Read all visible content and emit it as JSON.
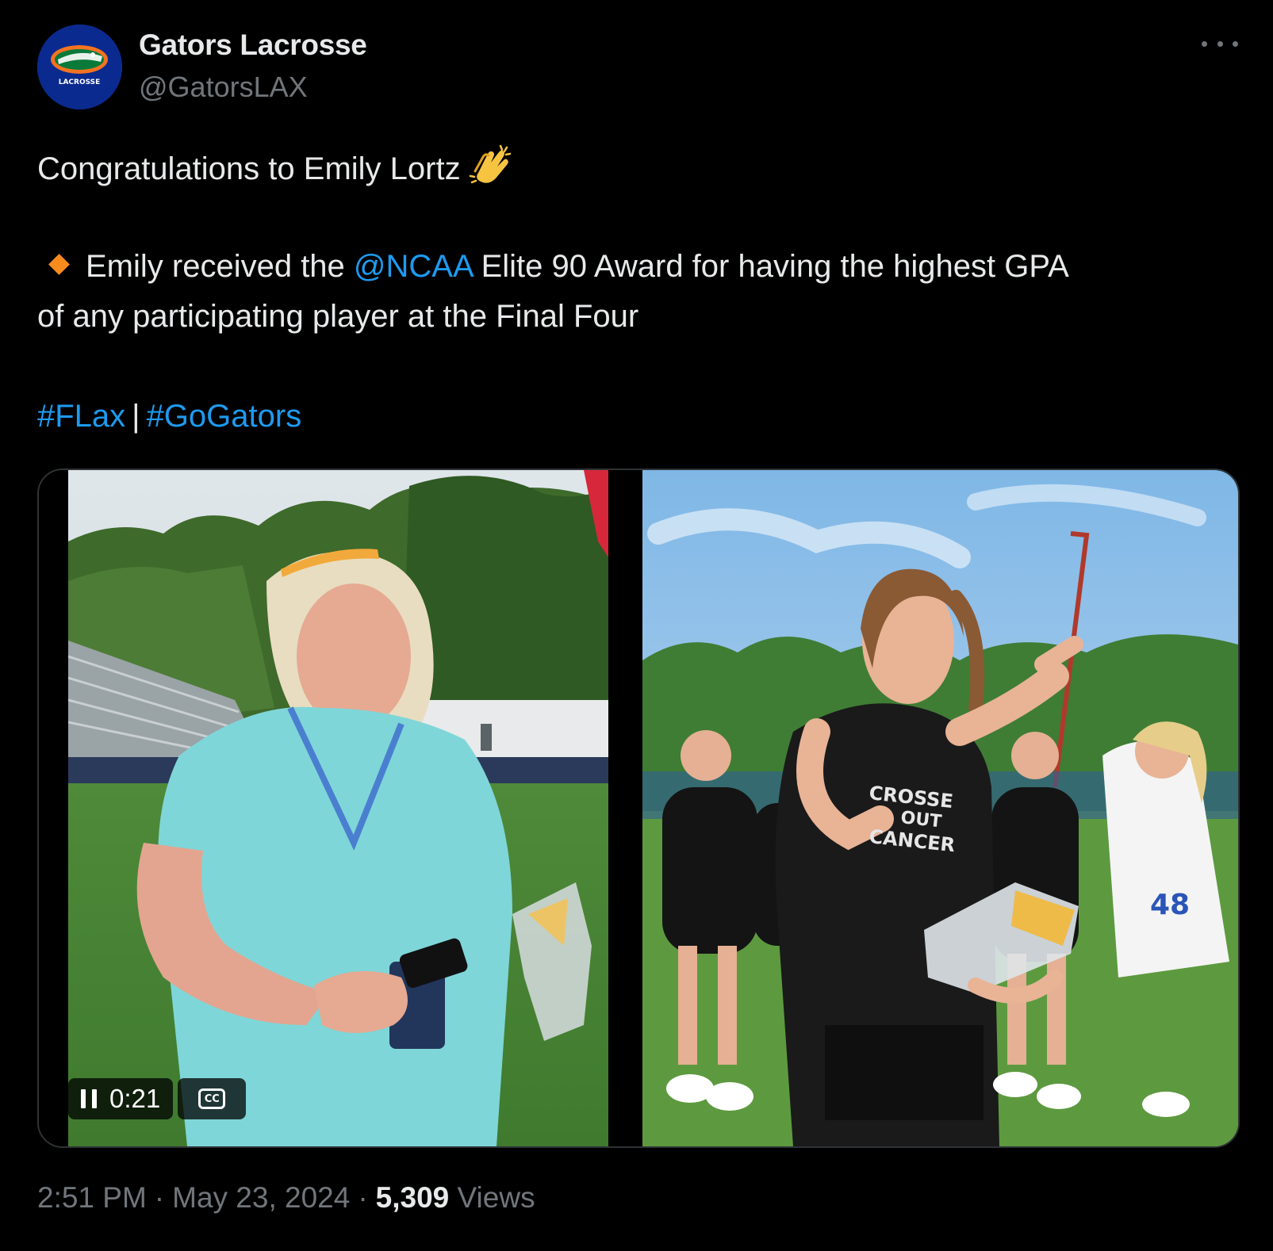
{
  "author": {
    "display_name": "Gators Lacrosse",
    "handle": "@GatorsLAX",
    "avatar_icon": "gator-logo-icon",
    "avatar_text": "LACROSSE"
  },
  "more_icon": "more-horizontal-icon",
  "tweet": {
    "line1": "Congratulations to Emily Lortz",
    "clap_icon": "clapping-hands-emoji",
    "bullet_icon": "orange-diamond-emoji",
    "line2_before": "Emily received the",
    "mention": "@NCAA",
    "line2_after": "Elite 90 Award for having the highest GPA",
    "line3": "of any participating player at the Final Four",
    "hashtag1": "#FLax",
    "separator": "|",
    "hashtag2": "#GoGators"
  },
  "media": {
    "video_time": "0:21",
    "pause_icon": "pause-icon",
    "captions_icon": "cc-icon",
    "cc_label": "CC"
  },
  "footer": {
    "time": "2:51 PM",
    "dot": "·",
    "date": "May 23, 2024",
    "views_count": "5,309",
    "views_label": "Views"
  },
  "colors": {
    "background": "#000000",
    "text": "#e7e9ea",
    "secondary": "#71767b",
    "link": "#1d9bf0",
    "bullet": "#f78b1e"
  }
}
